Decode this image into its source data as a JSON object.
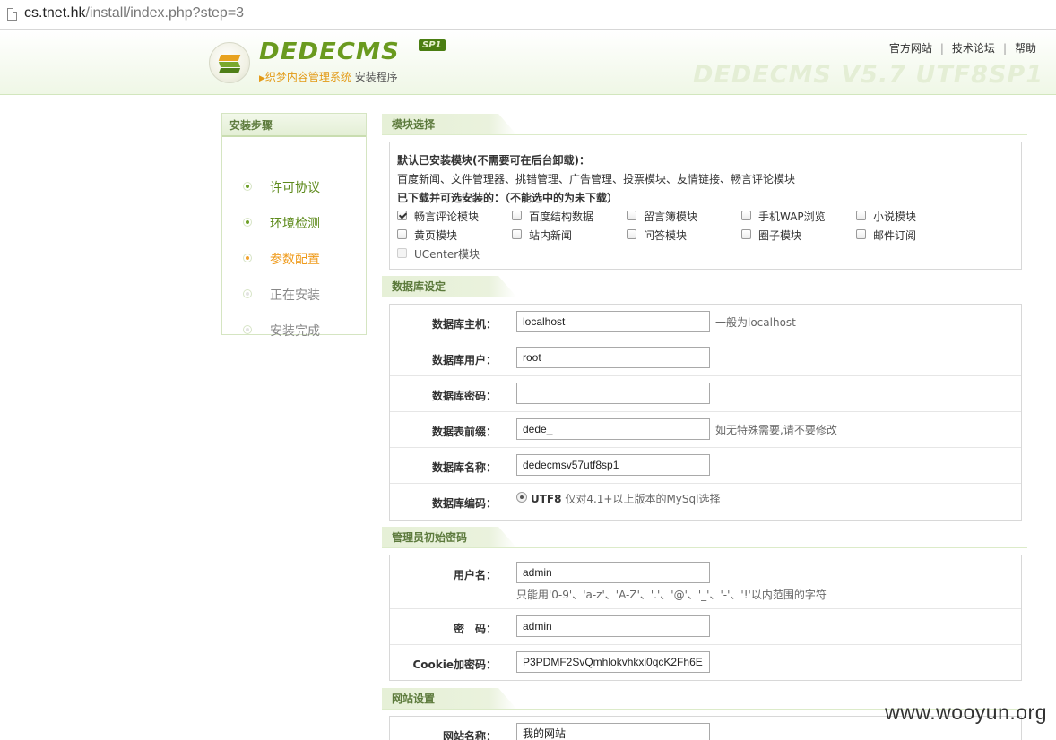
{
  "browser": {
    "url_host": "cs.tnet.hk",
    "url_path": "/install/index.php?step=3"
  },
  "header": {
    "logo_text": "DEDECMS",
    "logo_badge": "SP1",
    "brand": "织梦内容管理系统",
    "program": "安装程序",
    "links": [
      "官方网站",
      "技术论坛",
      "帮助"
    ],
    "version": "DEDECMS V5.7 UTF8SP1"
  },
  "sidebar": {
    "title": "安装步骤",
    "steps": [
      {
        "label": "许可协议",
        "state": "done"
      },
      {
        "label": "环境检测",
        "state": "done"
      },
      {
        "label": "参数配置",
        "state": "current"
      },
      {
        "label": "正在安装",
        "state": "todo"
      },
      {
        "label": "安装完成",
        "state": "todo"
      }
    ]
  },
  "modules": {
    "section_title": "模块选择",
    "default_title": "默认已安装模块(不需要可在后台卸载)：",
    "default_list": "百度新闻、文件管理器、挑错管理、广告管理、投票模块、友情链接、畅言评论模块",
    "optional_title": "已下载并可选安装的：（不能选中的为未下载）",
    "options": [
      {
        "label": "畅言评论模块",
        "checked": true,
        "disabled": false
      },
      {
        "label": "百度结构数据",
        "checked": false,
        "disabled": false
      },
      {
        "label": "留言簿模块",
        "checked": false,
        "disabled": false
      },
      {
        "label": "手机WAP浏览",
        "checked": false,
        "disabled": false
      },
      {
        "label": "小说模块",
        "checked": false,
        "disabled": false
      },
      {
        "label": "黄页模块",
        "checked": false,
        "disabled": false
      },
      {
        "label": "站内新闻",
        "checked": false,
        "disabled": false
      },
      {
        "label": "问答模块",
        "checked": false,
        "disabled": false
      },
      {
        "label": "圈子模块",
        "checked": false,
        "disabled": false
      },
      {
        "label": "邮件订阅",
        "checked": false,
        "disabled": false
      },
      {
        "label": "UCenter模块",
        "checked": false,
        "disabled": true
      }
    ]
  },
  "database": {
    "section_title": "数据库设定",
    "host_label": "数据库主机：",
    "host_value": "localhost",
    "host_hint": "一般为localhost",
    "user_label": "数据库用户：",
    "user_value": "root",
    "pass_label": "数据库密码：",
    "pass_value": "",
    "prefix_label": "数据表前缀：",
    "prefix_value": "dede_",
    "prefix_hint": "如无特殊需要,请不要修改",
    "name_label": "数据库名称：",
    "name_value": "dedecmsv57utf8sp1",
    "charset_label": "数据库编码：",
    "charset_value": "UTF8",
    "charset_hint": "仅对4.1+以上版本的MySql选择"
  },
  "admin": {
    "section_title": "管理员初始密码",
    "user_label": "用户名：",
    "user_value": "admin",
    "user_hint": "只能用'0-9'、'a-z'、'A-Z'、'.'、'@'、'_'、'-'、'!'以内范围的字符",
    "pass_label": "密　码：",
    "pass_value": "admin",
    "cookie_label": "Cookie加密码：",
    "cookie_value": "P3PDMF2SvQmhlokvhkxi0qcK2Fh6E"
  },
  "site": {
    "section_title": "网站设置",
    "name_label": "网站名称：",
    "name_value": "我的网站"
  },
  "watermark": "www.wooyun.org"
}
